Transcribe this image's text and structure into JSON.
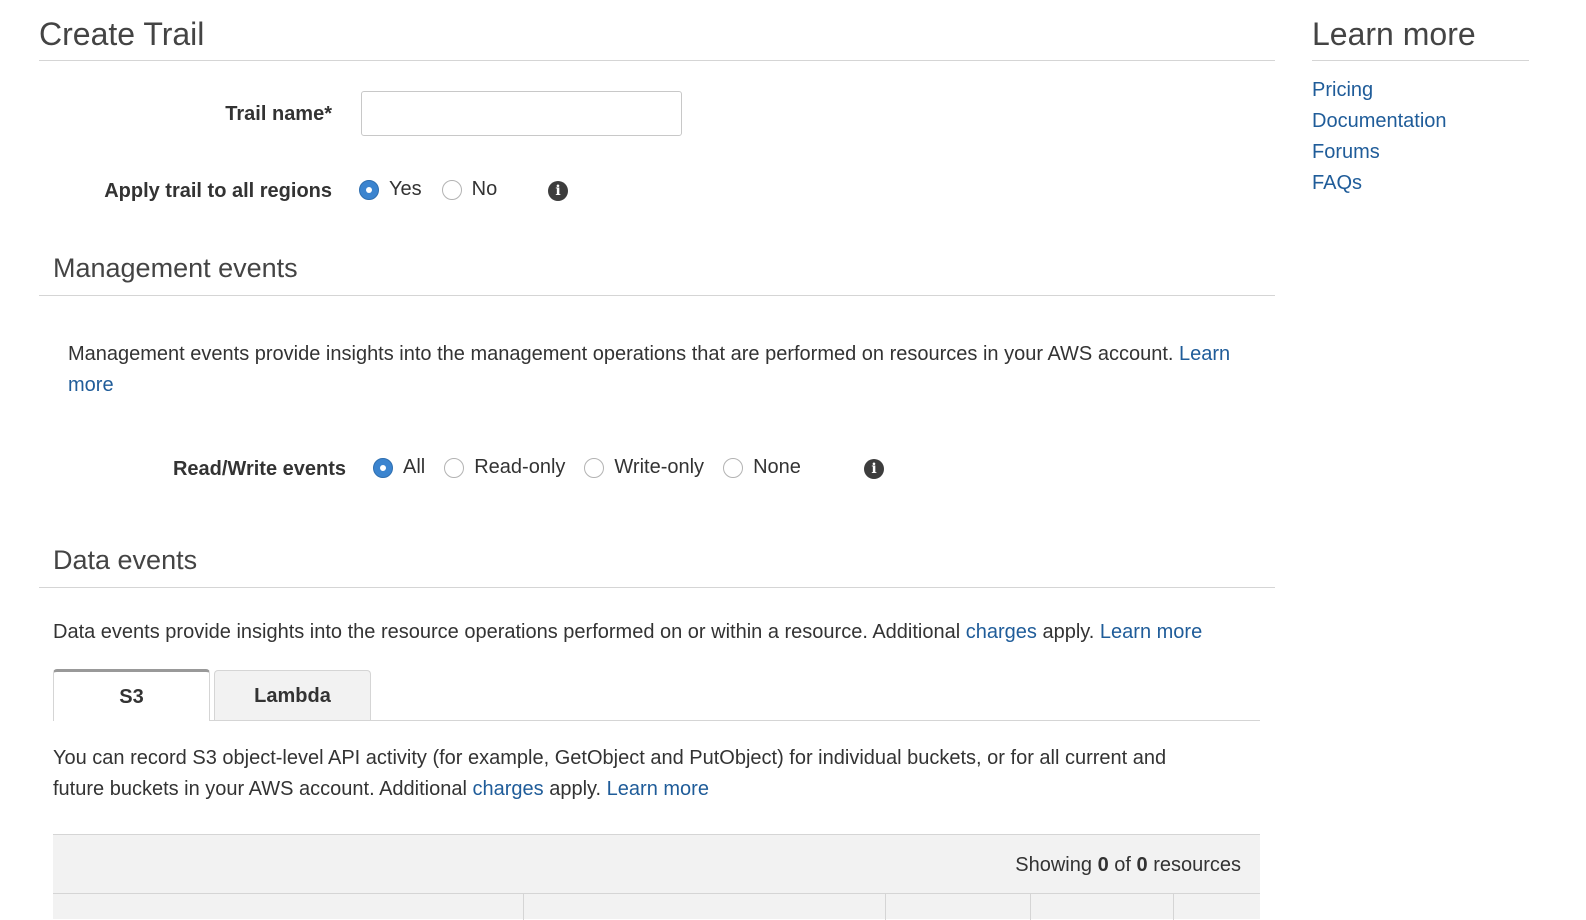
{
  "main": {
    "title": "Create Trail",
    "trail_name": {
      "label": "Trail name*",
      "value": "",
      "placeholder": ""
    },
    "apply_all_regions": {
      "label": "Apply trail to all regions",
      "options": [
        "Yes",
        "No"
      ],
      "selected": "Yes"
    },
    "management_events": {
      "heading": "Management events",
      "description": "Management events provide insights into the management operations that are performed on resources in your AWS account.",
      "learn_more_1": "Learn",
      "learn_more_2": "more",
      "read_write": {
        "label": "Read/Write events",
        "options": [
          "All",
          "Read-only",
          "Write-only",
          "None"
        ],
        "selected": "All"
      }
    },
    "data_events": {
      "heading": "Data events",
      "description": "Data events provide insights into the resource operations performed on or within a resource. Additional",
      "charges": "charges",
      "apply": "apply.",
      "learn_more": "Learn more",
      "tabs": [
        {
          "label": "S3",
          "active": true
        },
        {
          "label": "Lambda",
          "active": false
        }
      ],
      "s3": {
        "line1": "You can record S3 object-level API activity (for example, GetObject and PutObject) for individual buckets, or for all current and",
        "line2": "future buckets in your AWS account. Additional",
        "charges": "charges",
        "apply": "apply.",
        "learn_more": "Learn more"
      },
      "table": {
        "showing_prefix": "Showing",
        "shown_count": "0",
        "of": "of",
        "total": "0",
        "suffix": "resources"
      }
    }
  },
  "sidebar": {
    "title": "Learn more",
    "links": [
      "Pricing",
      "Documentation",
      "Forums",
      "FAQs"
    ]
  },
  "colors": {
    "link": "#1f5c99",
    "radio_selected": "#3b84cf"
  },
  "icons": {
    "info": "info-icon"
  }
}
